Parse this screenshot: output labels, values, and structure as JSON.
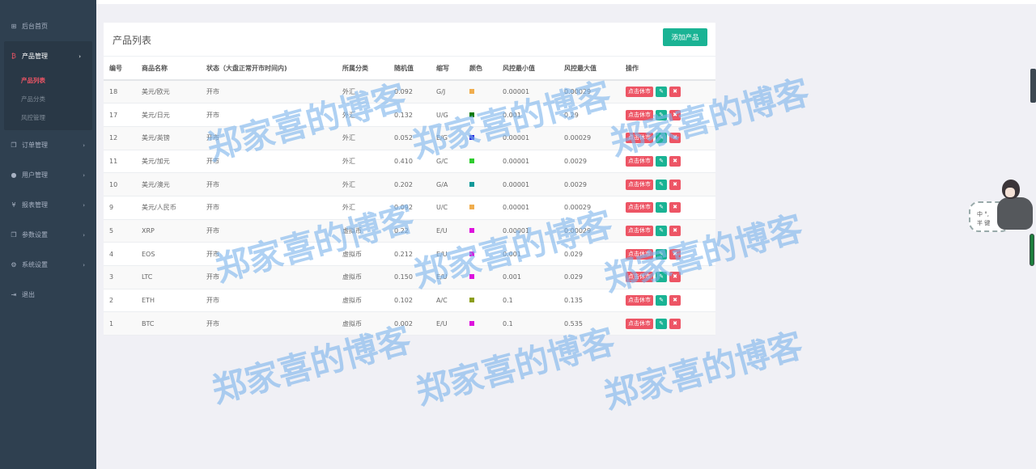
{
  "sidebar": {
    "items": [
      {
        "icon": "dashboard-icon",
        "label": "后台首页"
      },
      {
        "icon": "bitcoin-icon",
        "label": "产品管理"
      },
      {
        "icon": "copy-icon",
        "label": "订单管理"
      },
      {
        "icon": "user-icon",
        "label": "用户管理"
      },
      {
        "icon": "yen-icon",
        "label": "报表管理"
      },
      {
        "icon": "copy-icon",
        "label": "参数设置"
      },
      {
        "icon": "gears-icon",
        "label": "系统设置"
      },
      {
        "icon": "logout-icon",
        "label": "退出"
      }
    ],
    "product_sub": [
      "产品列表",
      "产品分类",
      "风控管理"
    ]
  },
  "panel": {
    "title": "产品列表",
    "add_button": "添加产品"
  },
  "table": {
    "headers": [
      "编号",
      "商品名称",
      "状态（大盘正常开市时间内)",
      "所属分类",
      "随机值",
      "缩写",
      "颜色",
      "风控最小值",
      "风控最大值",
      "操作"
    ],
    "rows": [
      {
        "id": "18",
        "name": "美元/欧元",
        "status": "开市",
        "category": "外汇",
        "random": "0.092",
        "abbr": "G/J",
        "color": "#f0ad4e",
        "min": "0.00001",
        "max": "0.00029"
      },
      {
        "id": "17",
        "name": "美元/日元",
        "status": "开市",
        "category": "外汇",
        "random": "0.132",
        "abbr": "U/G",
        "color": "#0b7a0b",
        "min": "0.001",
        "max": "0.29"
      },
      {
        "id": "12",
        "name": "美元/英镑",
        "status": "开市",
        "category": "外汇",
        "random": "0.052",
        "abbr": "E/G",
        "color": "#2222dd",
        "min": "0.00001",
        "max": "0.00029"
      },
      {
        "id": "11",
        "name": "美元/加元",
        "status": "开市",
        "category": "外汇",
        "random": "0.410",
        "abbr": "G/C",
        "color": "#2fcc2f",
        "min": "0.00001",
        "max": "0.0029"
      },
      {
        "id": "10",
        "name": "美元/澳元",
        "status": "开市",
        "category": "外汇",
        "random": "0.202",
        "abbr": "G/A",
        "color": "#119999",
        "min": "0.00001",
        "max": "0.0029"
      },
      {
        "id": "9",
        "name": "美元/人民币",
        "status": "开市",
        "category": "外汇",
        "random": "0.092",
        "abbr": "U/C",
        "color": "#f0ad4e",
        "min": "0.00001",
        "max": "0.00029"
      },
      {
        "id": "5",
        "name": "XRP",
        "status": "开市",
        "category": "虚拟币",
        "random": "0.22",
        "abbr": "E/U",
        "color": "#dd11dd",
        "min": "0.00001",
        "max": "0.00029"
      },
      {
        "id": "4",
        "name": "EOS",
        "status": "开市",
        "category": "虚拟币",
        "random": "0.212",
        "abbr": "E/U",
        "color": "#dd11dd",
        "min": "0.001",
        "max": "0.029"
      },
      {
        "id": "3",
        "name": "LTC",
        "status": "开市",
        "category": "虚拟币",
        "random": "0.150",
        "abbr": "E/U",
        "color": "#dd11dd",
        "min": "0.001",
        "max": "0.029"
      },
      {
        "id": "2",
        "name": "ETH",
        "status": "开市",
        "category": "虚拟币",
        "random": "0.102",
        "abbr": "A/C",
        "color": "#8c9e1a",
        "min": "0.1",
        "max": "0.135"
      },
      {
        "id": "1",
        "name": "BTC",
        "status": "开市",
        "category": "虚拟币",
        "random": "0.002",
        "abbr": "E/U",
        "color": "#dd11dd",
        "min": "0.1",
        "max": "0.535"
      }
    ],
    "halt_button": "点击休市"
  },
  "watermark": "郑家喜的博客",
  "mascot": {
    "line1": "中 °,",
    "line2": "半 键"
  }
}
